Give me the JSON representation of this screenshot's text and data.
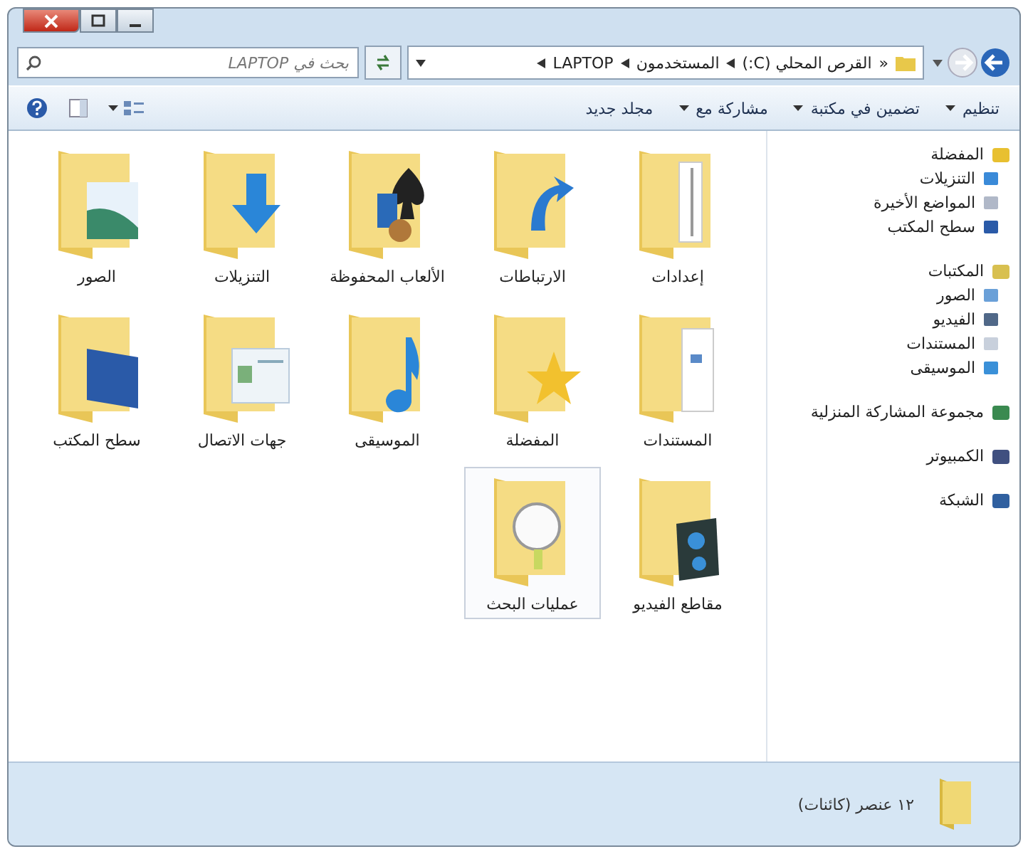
{
  "address": {
    "crumbs": [
      "القرص المحلي (C:)",
      "المستخدمون",
      "LAPTOP"
    ],
    "overflow": "«"
  },
  "search": {
    "placeholder": "بحث في LAPTOP"
  },
  "toolbar": {
    "buttons": [
      {
        "label": "تنظيم",
        "dropdown": true
      },
      {
        "label": "تضمين في مكتبة",
        "dropdown": true
      },
      {
        "label": "مشاركة مع",
        "dropdown": true
      },
      {
        "label": "مجلد جديد",
        "dropdown": false
      }
    ]
  },
  "sidebar": {
    "groups": [
      {
        "header": "المفضلة",
        "kind": "favorites",
        "items": [
          {
            "label": "التنزيلات",
            "kind": "downloads"
          },
          {
            "label": "المواضع الأخيرة",
            "kind": "recent"
          },
          {
            "label": "سطح المكتب",
            "kind": "desktop"
          }
        ]
      },
      {
        "header": "المكتبات",
        "kind": "libraries",
        "items": [
          {
            "label": "الصور",
            "kind": "pictures"
          },
          {
            "label": "الفيديو",
            "kind": "video"
          },
          {
            "label": "المستندات",
            "kind": "documents"
          },
          {
            "label": "الموسيقى",
            "kind": "music"
          }
        ]
      },
      {
        "header": "مجموعة المشاركة المنزلية",
        "kind": "homegroup"
      },
      {
        "header": "الكمبيوتر",
        "kind": "computer"
      },
      {
        "header": "الشبكة",
        "kind": "network"
      }
    ]
  },
  "folders": [
    {
      "label": "إعدادات",
      "kind": "paper",
      "selected": false
    },
    {
      "label": "الارتباطات",
      "kind": "links",
      "selected": false
    },
    {
      "label": "الألعاب المحفوظة",
      "kind": "games",
      "selected": false
    },
    {
      "label": "التنزيلات",
      "kind": "downloads",
      "selected": false
    },
    {
      "label": "الصور",
      "kind": "pictures",
      "selected": false
    },
    {
      "label": "المستندات",
      "kind": "documents",
      "selected": false
    },
    {
      "label": "المفضلة",
      "kind": "favorites",
      "selected": false
    },
    {
      "label": "الموسيقى",
      "kind": "music",
      "selected": false
    },
    {
      "label": "جهات الاتصال",
      "kind": "contacts",
      "selected": false
    },
    {
      "label": "سطح المكتب",
      "kind": "desktop",
      "selected": false
    },
    {
      "label": "مقاطع الفيديو",
      "kind": "video",
      "selected": false
    },
    {
      "label": "عمليات البحث",
      "kind": "search",
      "selected": true
    }
  ],
  "details": {
    "text": "١٢ عنصر (كائنات)"
  }
}
